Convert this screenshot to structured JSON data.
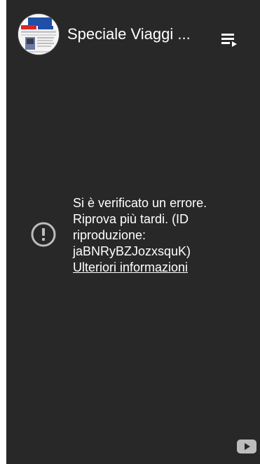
{
  "header": {
    "channel_title": "Speciale Viaggi ...",
    "avatar_icon": "travel-magazine-thumbnail",
    "playlist_icon": "playlist-play-icon"
  },
  "error": {
    "icon": "exclamation-circle-icon",
    "message": "Si è verificato un errore. Riprova più tardi. (ID riproduzione: jaBNRyBZJozxsquK)",
    "link_text": "Ulteriori informazioni"
  },
  "footer": {
    "logo_icon": "youtube-logo-icon"
  },
  "colors": {
    "player_background": "#282828",
    "text": "#ffffff",
    "icon_muted": "#bdbdbd"
  }
}
